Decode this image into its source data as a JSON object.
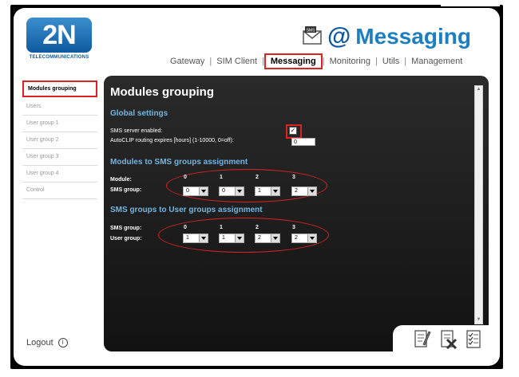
{
  "brand": {
    "logo_text": "2N",
    "logo_sub": "TELECOMMUNICATIONS"
  },
  "header": {
    "title": "Messaging",
    "at_symbol": "@",
    "sms_badge": "SMS"
  },
  "topnav": {
    "items": [
      "Gateway",
      "SIM Client",
      "Messaging",
      "Monitoring",
      "Utils",
      "Management"
    ],
    "active": "Messaging",
    "separator": "|"
  },
  "sidebar": {
    "items": [
      "Modules grouping",
      "Users",
      "User group 1",
      "User group 2",
      "User group 3",
      "User group 4",
      "Control"
    ],
    "active": "Modules grouping",
    "logout": "Logout",
    "logout_icon": "i"
  },
  "panel": {
    "title": "Modules grouping",
    "global": {
      "heading": "Global settings",
      "sms_server_label": "SMS server enabled:",
      "sms_server_checked": "✓",
      "autoclip_label": "AutoCLIP routing expires [hours] (1-10000, 0=off):",
      "autoclip_value": "0"
    },
    "modules_to_sms": {
      "heading": "Modules to SMS groups assignment",
      "row1_label": "Module:",
      "row2_label": "SMS group:",
      "columns": [
        "0",
        "1",
        "2",
        "3"
      ],
      "values": [
        "0",
        "0",
        "1",
        "2"
      ]
    },
    "sms_to_user": {
      "heading": "SMS groups to User groups assignment",
      "row1_label": "SMS group:",
      "row2_label": "User group:",
      "columns": [
        "0",
        "1",
        "2",
        "3"
      ],
      "values": [
        "1",
        "1",
        "2",
        "2"
      ]
    },
    "scroll_up": "▲",
    "scroll_down": "▼"
  },
  "toolbar": {
    "icons": [
      "edit-icon",
      "delete-icon",
      "checklist-icon"
    ]
  },
  "colors": {
    "accent": "#1b7fc2",
    "highlight": "#dd2222",
    "panel": "#1a1a1a",
    "section": "#6fb6e6"
  }
}
